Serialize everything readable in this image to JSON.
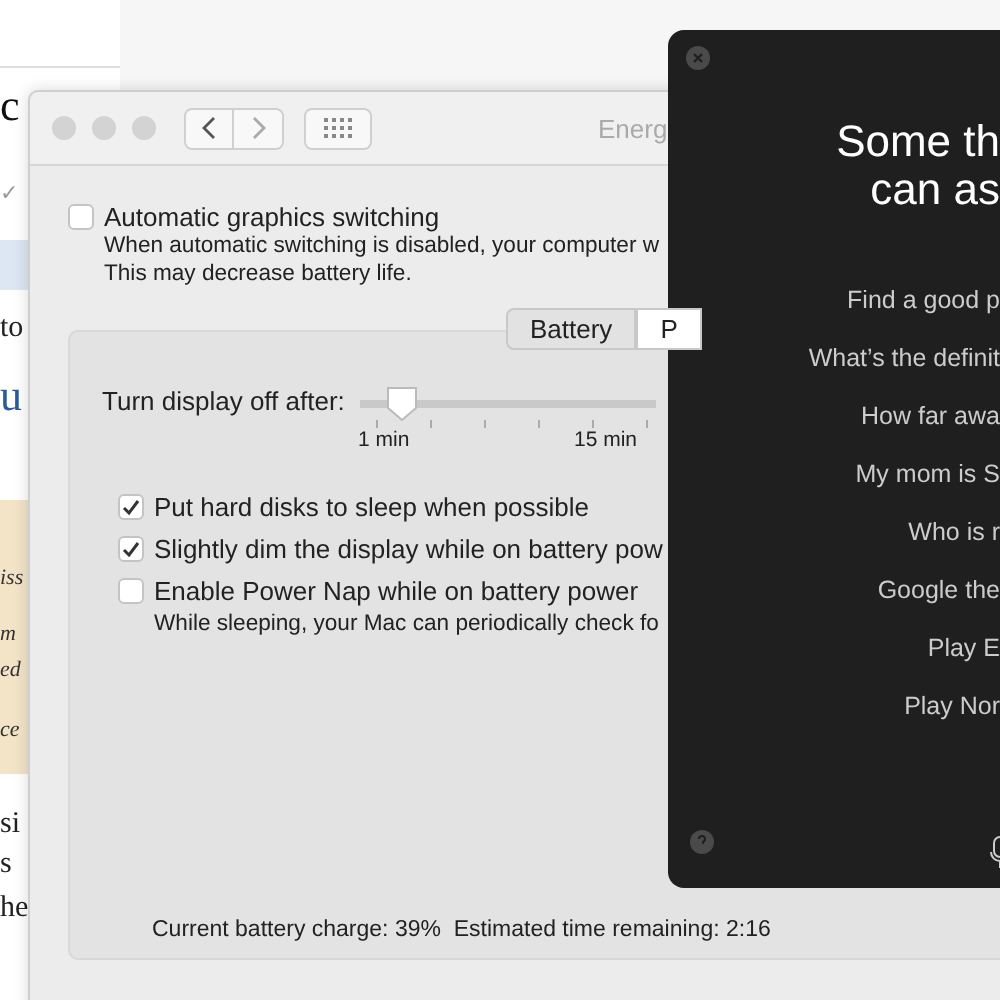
{
  "background_page": {
    "texts": [
      {
        "text": "c",
        "kind": "heading"
      },
      {
        "text": "✓",
        "kind": "mark"
      },
      {
        "text": "to",
        "kind": "body"
      },
      {
        "text": "u",
        "kind": "link"
      },
      {
        "text": "iss",
        "kind": "quote"
      },
      {
        "text": "m",
        "kind": "quote"
      },
      {
        "text": "ed",
        "kind": "quote"
      },
      {
        "text": "ce",
        "kind": "quote"
      },
      {
        "text": "si",
        "kind": "body"
      },
      {
        "text": "s",
        "kind": "body"
      },
      {
        "text": "he",
        "kind": "body"
      }
    ]
  },
  "preferences_window": {
    "title": "Energ",
    "graphics_switching": {
      "label": "Automatic graphics switching",
      "checked": false,
      "notes": [
        "When automatic switching is disabled, your computer w",
        "This may decrease battery life."
      ]
    },
    "tabs": [
      {
        "label": "Battery",
        "selected": true
      },
      {
        "label": "P",
        "selected": false
      }
    ],
    "display_slider": {
      "label": "Turn display off after:",
      "level": 0.14,
      "tick_labels": [
        "1 min",
        "15 min"
      ]
    },
    "options": [
      {
        "label": "Put hard disks to sleep when possible",
        "checked": true
      },
      {
        "label": "Slightly dim the display while on battery pow",
        "checked": true
      },
      {
        "label": "Enable Power Nap while on battery power",
        "checked": false,
        "note": "While sleeping, your Mac can periodically check fo"
      }
    ],
    "status": "Current battery charge: 39%  Estimated time remaining: 2:16"
  },
  "siri_panel": {
    "title_lines": [
      "Some th",
      "can as"
    ],
    "suggestions": [
      "Find a good p",
      "What’s the definit",
      "How far awa",
      "My mom is S",
      "Who is r",
      "Google the",
      "Play E",
      "Play Nor"
    ]
  }
}
